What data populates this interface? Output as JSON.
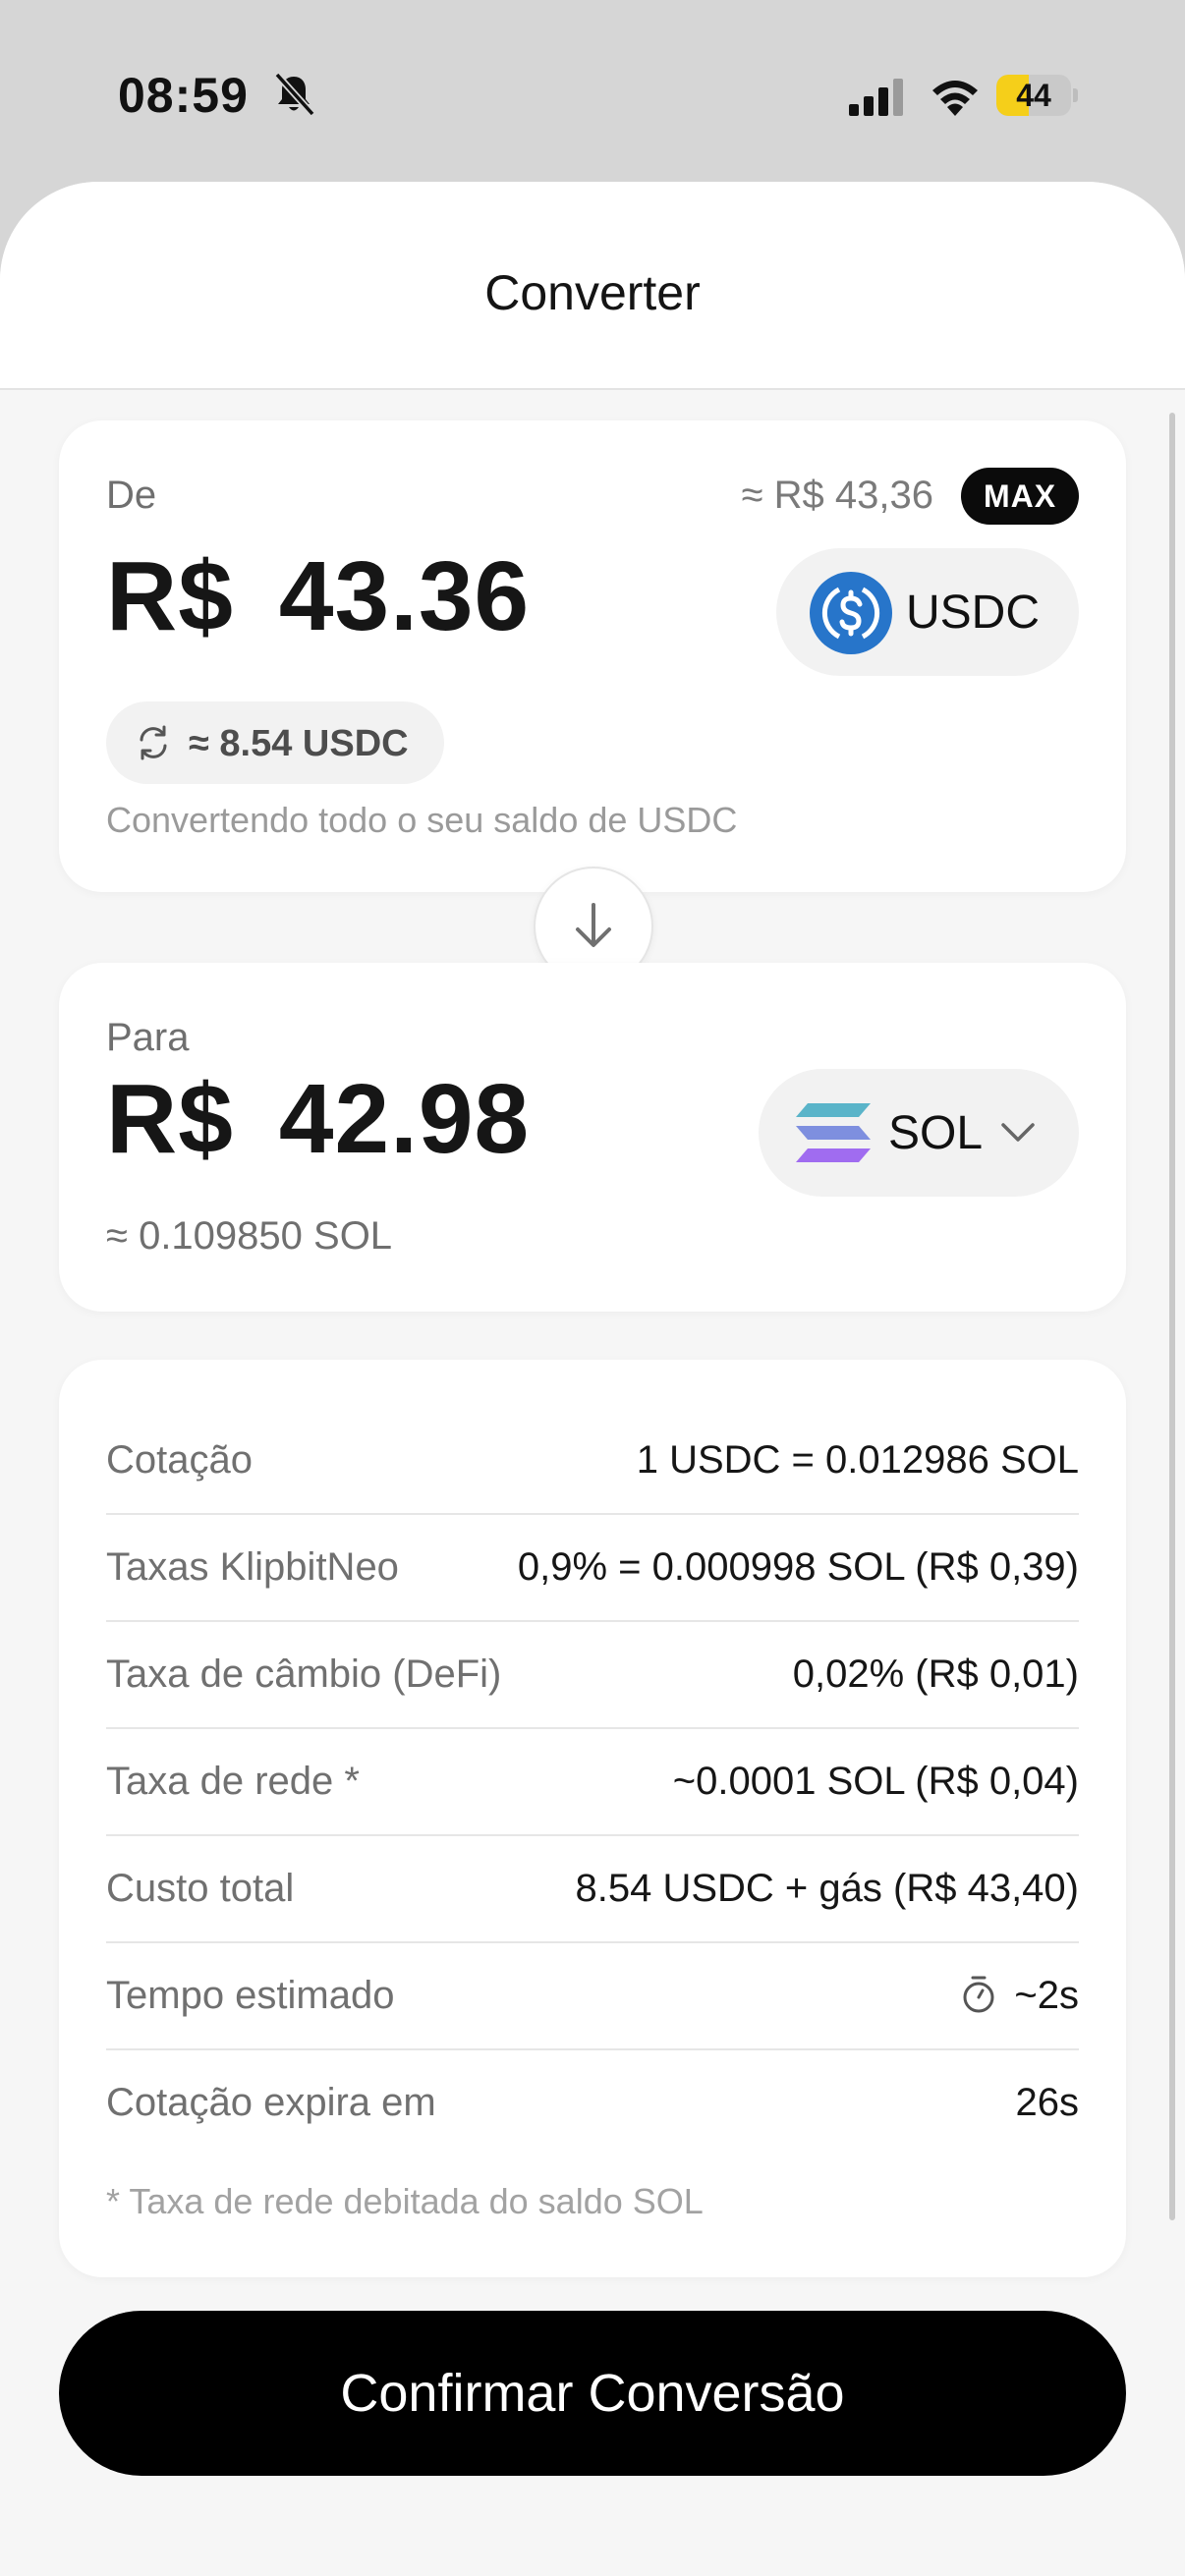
{
  "status_bar": {
    "time": "08:59",
    "battery": "44"
  },
  "header": {
    "title": "Converter"
  },
  "from": {
    "label": "De",
    "approx_fiat": "≈ R$ 43,36",
    "max_label": "MAX",
    "currency_symbol": "R$",
    "amount": "43.36",
    "token": "USDC",
    "converted_amount": "≈ 8.54 USDC",
    "note": "Convertendo todo o seu saldo de USDC"
  },
  "to": {
    "label": "Para",
    "currency_symbol": "R$",
    "amount": "42.98",
    "token": "SOL",
    "approx_token": "≈ 0.109850 SOL"
  },
  "details": {
    "rows": [
      {
        "label": "Cotação",
        "value": "1 USDC = 0.012986 SOL"
      },
      {
        "label": "Taxas KlipbitNeo",
        "value": "0,9% = 0.000998 SOL (R$ 0,39)"
      },
      {
        "label": "Taxa de câmbio (DeFi)",
        "value": "0,02% (R$ 0,01)"
      },
      {
        "label": "Taxa de rede *",
        "value": "~0.0001 SOL (R$ 0,04)"
      },
      {
        "label": "Custo total",
        "value": "8.54 USDC + gás (R$ 43,40)"
      },
      {
        "label": "Tempo estimado",
        "value": "~2s"
      },
      {
        "label": "Cotação expira em",
        "value": "26s"
      }
    ],
    "footnote": "* Taxa de rede debitada do saldo SOL"
  },
  "confirm_label": "Confirmar Conversão",
  "colors": {
    "usdc_blue": "#2775ca",
    "sol_teal": "#5ab4c9",
    "sol_purple": "#a06cf0",
    "battery_yellow": "#f5cf1a",
    "button_black": "#000000"
  }
}
